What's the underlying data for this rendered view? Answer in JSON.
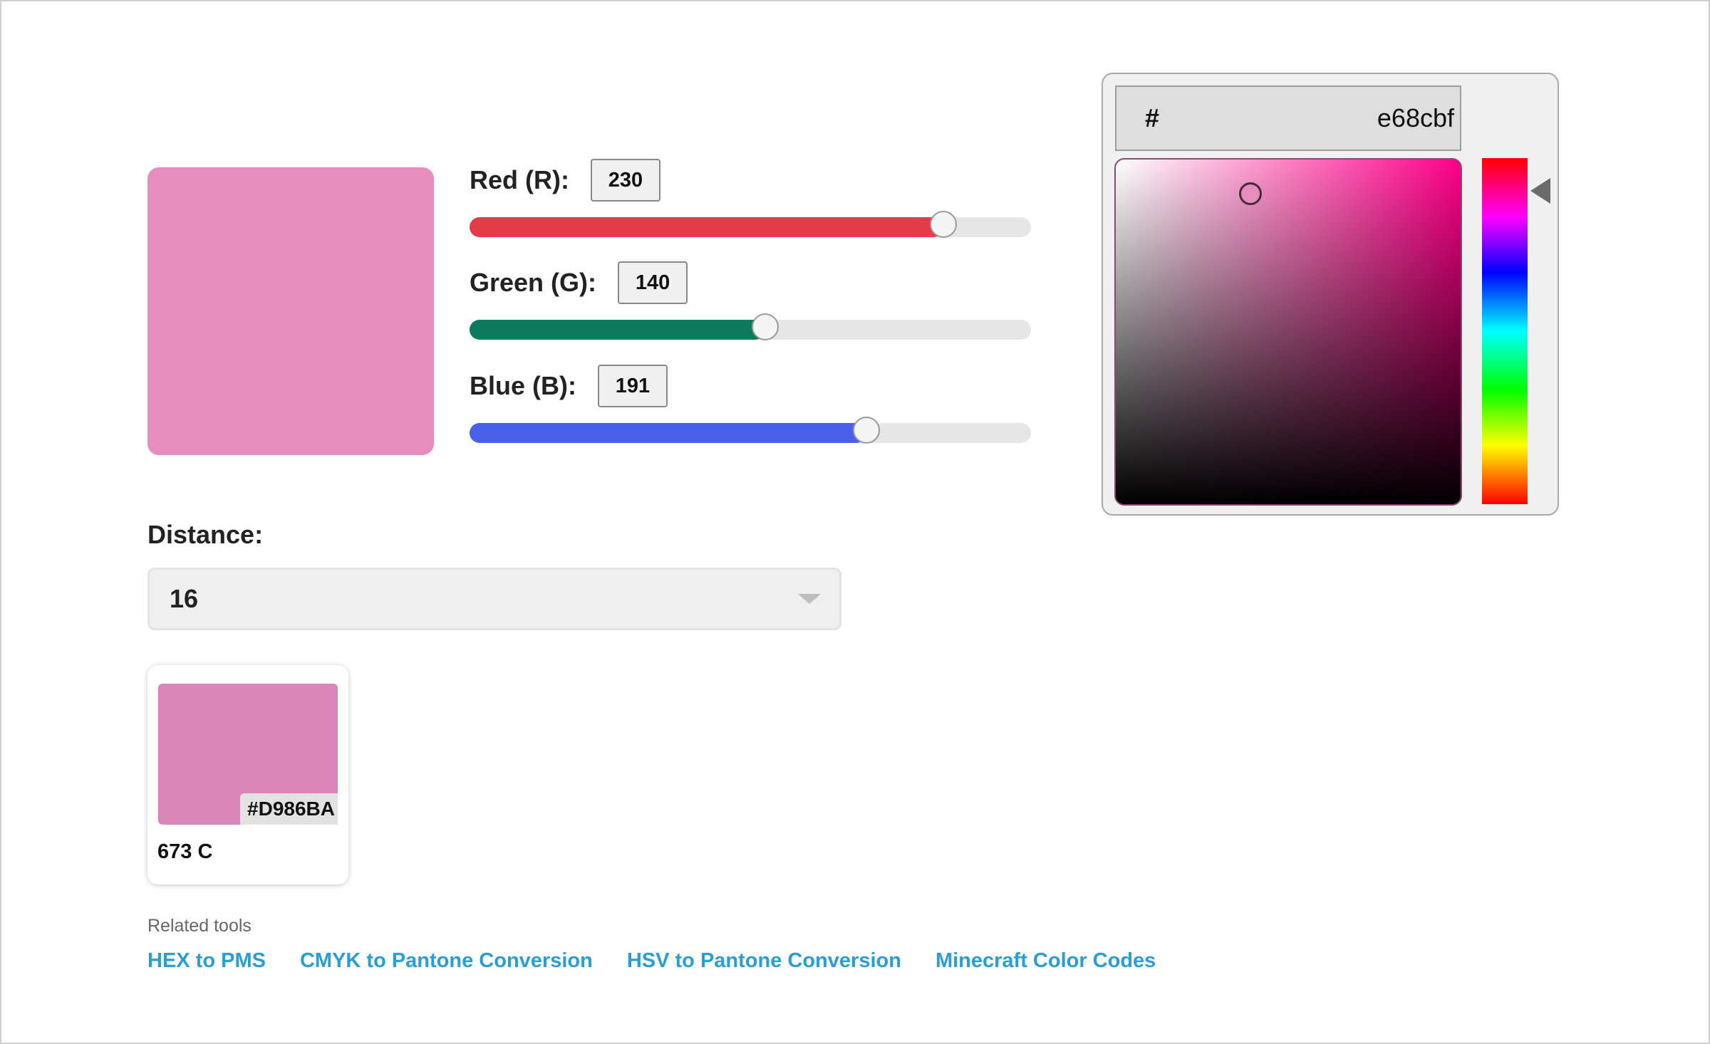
{
  "preview": {
    "color": "#e68cbf"
  },
  "sliders": [
    {
      "label": "Red (R):",
      "value": "230",
      "level": 230,
      "max": 255,
      "color": "#e33b48"
    },
    {
      "label": "Green (G):",
      "value": "140",
      "level": 140,
      "max": 255,
      "color": "#0c7a5c"
    },
    {
      "label": "Blue (B):",
      "value": "191",
      "level": 191,
      "max": 255,
      "color": "#4a60e8"
    }
  ],
  "distance": {
    "label": "Distance:",
    "selected": "16"
  },
  "result": {
    "color": "#D986BA",
    "hex": "#D986BA",
    "name": "673 C"
  },
  "related": {
    "title": "Related tools",
    "links": [
      "HEX to PMS",
      "CMYK to Pantone Conversion",
      "HSV to Pantone Conversion",
      "Minecraft Color Codes"
    ]
  },
  "picker": {
    "hash": "#",
    "hex": "e68cbf",
    "saturation": 0.39,
    "brightness": 0.9,
    "hue_degrees": 326,
    "icons": [
      "sv-cursor-icon",
      "hue-pointer-icon"
    ]
  }
}
